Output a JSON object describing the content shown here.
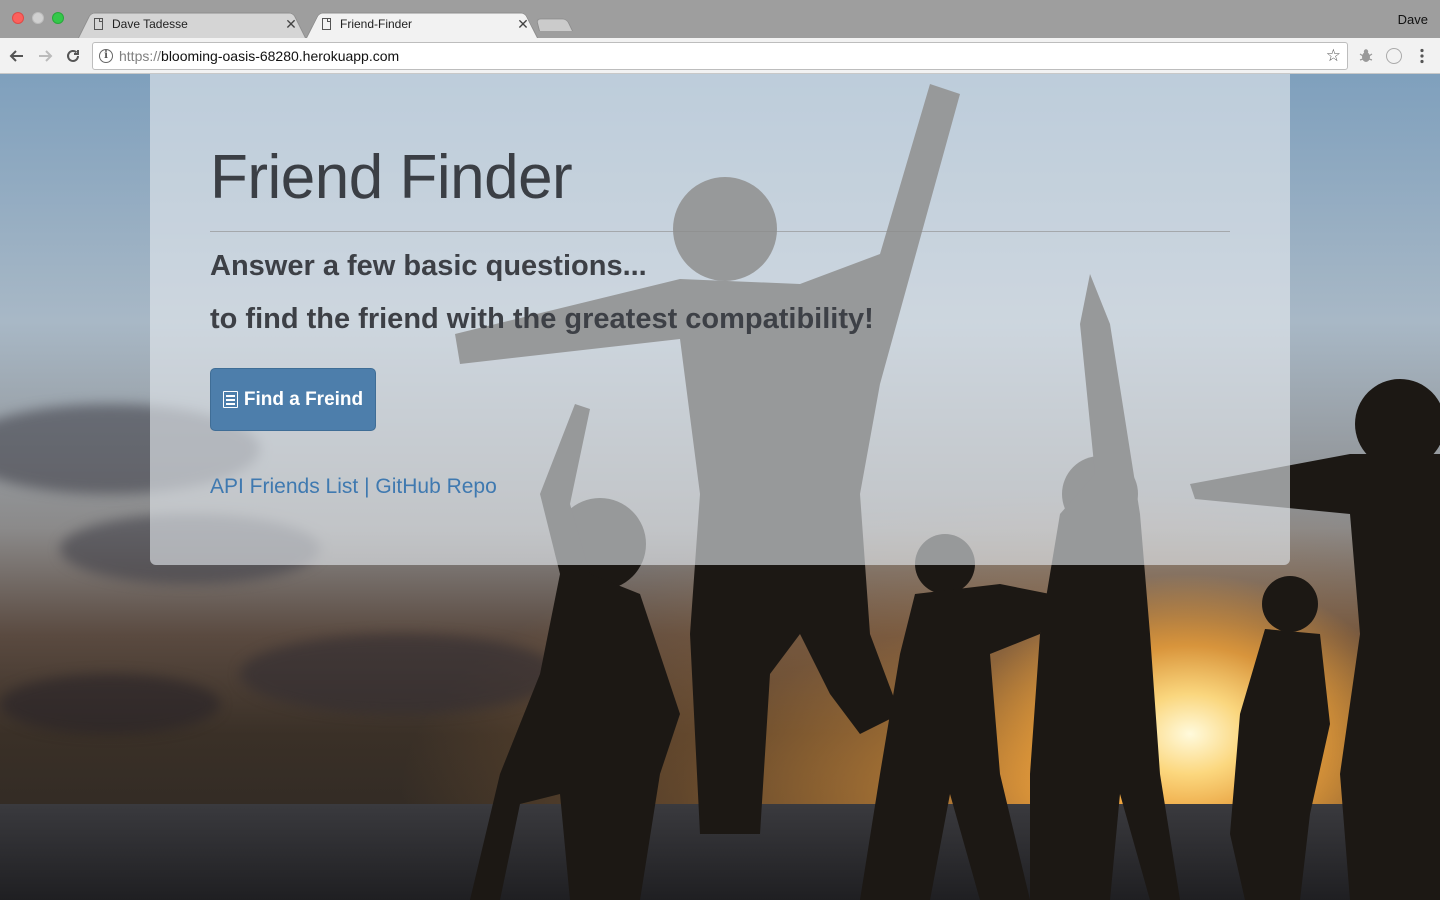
{
  "browser": {
    "tabs": [
      {
        "title": "Dave Tadesse",
        "active": false
      },
      {
        "title": "Friend-Finder",
        "active": true
      }
    ],
    "profile_name": "Dave",
    "url_scheme": "https://",
    "url_host": "blooming-oasis-68280.herokuapp.com",
    "icons": {
      "back": "back-arrow-icon",
      "forward": "forward-arrow-icon",
      "reload": "reload-icon",
      "info": "info-icon",
      "bookmark": "star-icon",
      "extension1": "bug-icon",
      "extension2": "circle-icon",
      "menu": "kebab-menu-icon"
    }
  },
  "page": {
    "title": "Friend Finder",
    "lead_line1": "Answer a few basic questions...",
    "lead_line2": "to find the friend with the greatest compatibility!",
    "primary_button": "Find a Freind",
    "links": {
      "api": "API Friends List",
      "separator": "|",
      "github": "GitHub Repo"
    },
    "colors": {
      "button_bg": "#4d7eab",
      "link": "#3f79b0",
      "heading": "#3b3f45"
    }
  }
}
